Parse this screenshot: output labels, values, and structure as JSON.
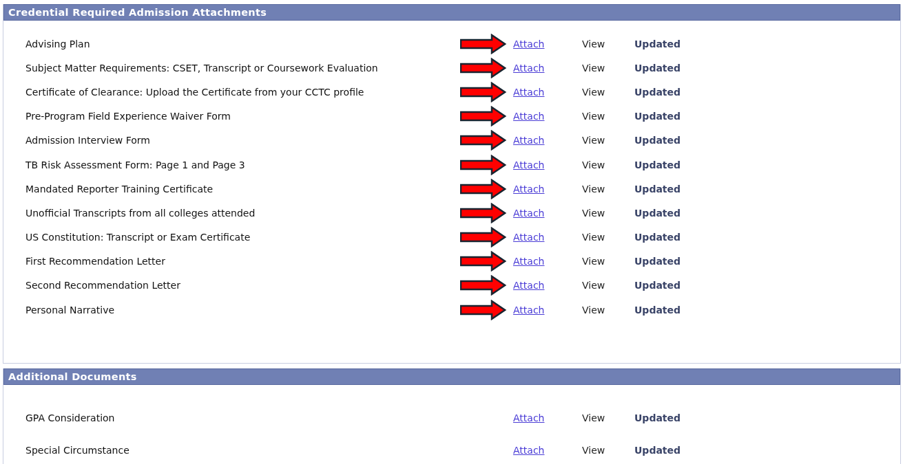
{
  "sections": [
    {
      "title": "Credential Required Admission Attachments",
      "rows": [
        {
          "label": "Advising Plan",
          "arrow": true,
          "attach": "Attach",
          "view": "View",
          "status": "Updated"
        },
        {
          "label": "Subject Matter Requirements: CSET, Transcript or Coursework Evaluation",
          "arrow": true,
          "attach": "Attach",
          "view": "View",
          "status": "Updated"
        },
        {
          "label": "Certificate of Clearance: Upload the Certificate from your CCTC profile",
          "arrow": true,
          "attach": "Attach",
          "view": "View",
          "status": "Updated"
        },
        {
          "label": "Pre-Program Field Experience Waiver Form",
          "arrow": true,
          "attach": "Attach",
          "view": "View",
          "status": "Updated"
        },
        {
          "label": "Admission Interview Form",
          "arrow": true,
          "attach": "Attach",
          "view": "View",
          "status": "Updated"
        },
        {
          "label": "TB Risk Assessment Form: Page 1 and Page 3",
          "arrow": true,
          "attach": "Attach",
          "view": "View",
          "status": "Updated"
        },
        {
          "label": "Mandated Reporter Training Certificate",
          "arrow": true,
          "attach": "Attach",
          "view": "View",
          "status": "Updated"
        },
        {
          "label": "Unofficial Transcripts from all colleges attended",
          "arrow": true,
          "attach": "Attach",
          "view": "View",
          "status": "Updated"
        },
        {
          "label": "US Constitution: Transcript or Exam Certificate",
          "arrow": true,
          "attach": "Attach",
          "view": "View",
          "status": "Updated"
        },
        {
          "label": "First Recommendation Letter",
          "arrow": true,
          "attach": "Attach",
          "view": "View",
          "status": "Updated"
        },
        {
          "label": "Second Recommendation Letter",
          "arrow": true,
          "attach": "Attach",
          "view": "View",
          "status": "Updated"
        },
        {
          "label": "Personal Narrative",
          "arrow": true,
          "attach": "Attach",
          "view": "View",
          "status": "Updated"
        }
      ]
    },
    {
      "title": "Additional Documents",
      "rows": [
        {
          "label": "GPA Consideration",
          "arrow": false,
          "attach": "Attach",
          "view": "View",
          "status": "Updated"
        },
        {
          "label": "Special Circumstance",
          "arrow": false,
          "attach": "Attach",
          "view": "View",
          "status": "Updated"
        }
      ]
    }
  ]
}
